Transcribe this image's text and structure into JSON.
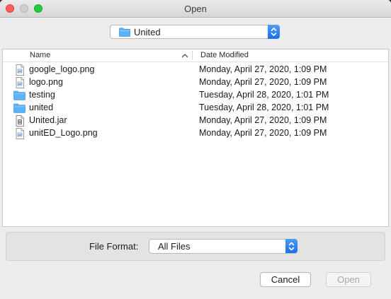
{
  "window": {
    "title": "Open"
  },
  "location": {
    "current_folder": "United",
    "icon": "folder-icon"
  },
  "file_list": {
    "columns": {
      "name": "Name",
      "date_modified": "Date Modified"
    },
    "sort": {
      "column": "name",
      "icon": "chevron-up-icon"
    },
    "rows": [
      {
        "name": "google_logo.png",
        "date": "Monday, April 27, 2020, 1:09 PM",
        "icon": "image-file-icon"
      },
      {
        "name": "logo.png",
        "date": "Monday, April 27, 2020, 1:09 PM",
        "icon": "image-file-icon"
      },
      {
        "name": "testing",
        "date": "Tuesday, April 28, 2020, 1:01 PM",
        "icon": "folder-icon"
      },
      {
        "name": "united",
        "date": "Tuesday, April 28, 2020, 1:01 PM",
        "icon": "folder-icon"
      },
      {
        "name": "United.jar",
        "date": "Monday, April 27, 2020, 1:09 PM",
        "icon": "jar-file-icon"
      },
      {
        "name": "unitED_Logo.png",
        "date": "Monday, April 27, 2020, 1:09 PM",
        "icon": "image-file-icon"
      }
    ]
  },
  "format": {
    "label": "File Format:",
    "selected": "All Files"
  },
  "buttons": {
    "cancel": "Cancel",
    "open": "Open",
    "open_enabled": false
  },
  "colors": {
    "accent": "#1c70e8",
    "folder": "#5cb3f5"
  }
}
